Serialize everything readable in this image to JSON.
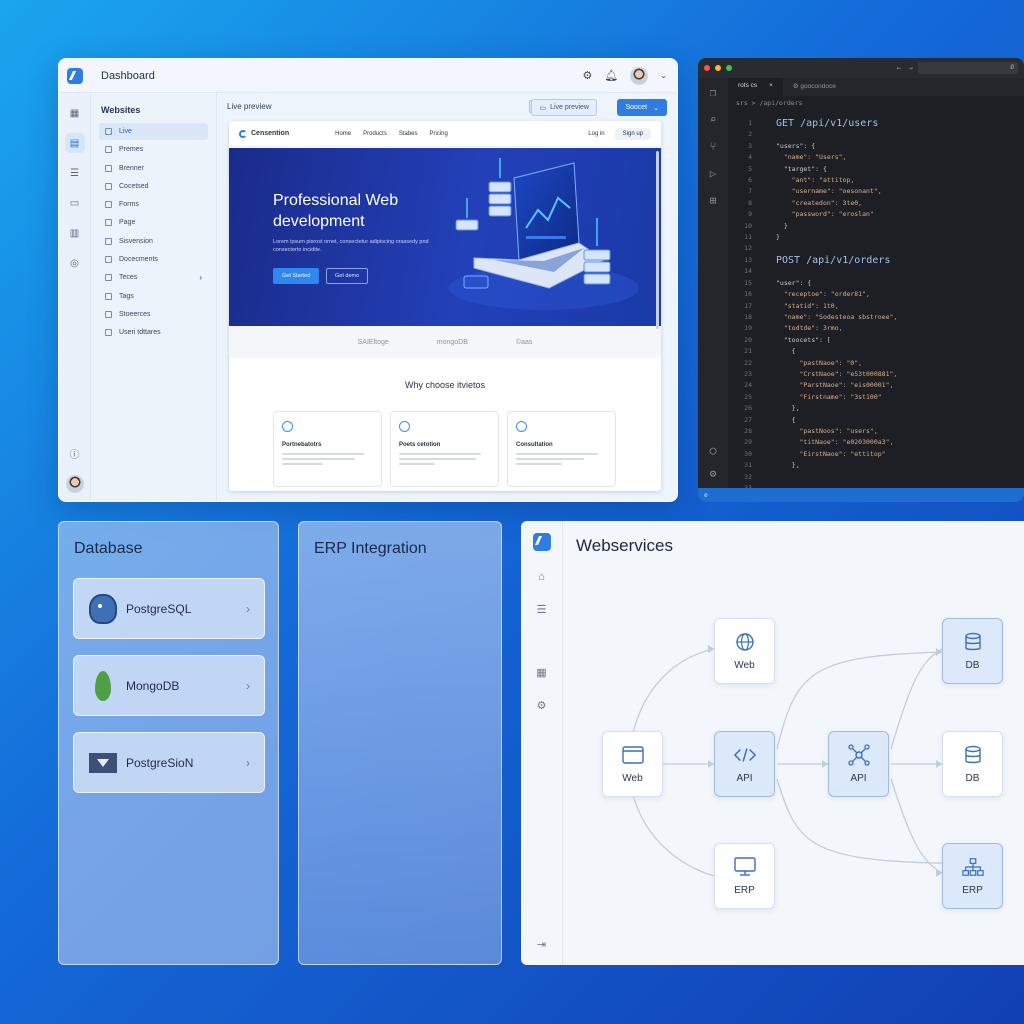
{
  "dashboard": {
    "title": "Dashboard",
    "sidebar_heading": "Websites",
    "sidebar_items": [
      "Live",
      "Premes",
      "Brenner",
      "Cocetsed",
      "Forms",
      "Page",
      "Sisvension",
      "Docecments",
      "Teces",
      "Tags",
      "Stoeerces",
      "Useri tdttares"
    ],
    "main_label": "Live preview",
    "btn_live_preview": "Live preview",
    "btn_secondary": "Soocet",
    "site": {
      "brand": "Censention",
      "nav": [
        "Home",
        "Products",
        "Stabes",
        "Pricing"
      ],
      "login": "Log in",
      "signup": "Sign up",
      "hero_title": "Professional Web development",
      "hero_text": "Lorem ipsum pisrost ornet, consectetur adipiscing orassedy pnd consecterto incidite.",
      "hero_btn_primary": "Get Started",
      "hero_btn_secondary": "Get demo",
      "logos": [
        "SAIEltoge",
        "mongoDB",
        "©aas"
      ],
      "why_title": "Why choose itvietos",
      "cards": [
        "Portnebatotrs",
        "Poets cetotion",
        "Consultation"
      ]
    }
  },
  "code_editor": {
    "tabs": [
      "rots cs",
      "goocondoce"
    ],
    "breadcrumb": "srs  >  /api/orders",
    "search": "Ø",
    "status": "⊘",
    "line_numbers": [
      "1",
      "2",
      "3",
      "4",
      "5",
      "6",
      "7",
      "8",
      "9",
      "10",
      "11",
      "12",
      "13",
      "14",
      "15",
      "16",
      "17",
      "18",
      "19",
      "20",
      "21",
      "22",
      "23",
      "24",
      "25",
      "26",
      "27",
      "28",
      "29",
      "30",
      "31",
      "32",
      "33"
    ],
    "code": [
      {
        "text": "GET /api/v1/users",
        "cls": "big kw"
      },
      {
        "text": "",
        "cls": ""
      },
      {
        "text": "\"users\": {",
        "cls": ""
      },
      {
        "text": "  \"name\": \"Users\",",
        "cls": "str"
      },
      {
        "text": "  \"target\": {",
        "cls": ""
      },
      {
        "text": "    \"ant\": \"attitop,",
        "cls": "str"
      },
      {
        "text": "    \"username\": \"oesonant\",",
        "cls": "str"
      },
      {
        "text": "    \"createdon\": 3te0,",
        "cls": "str"
      },
      {
        "text": "    \"password\": \"eroslan\"",
        "cls": "str"
      },
      {
        "text": "  }",
        "cls": ""
      },
      {
        "text": "}",
        "cls": ""
      },
      {
        "text": "",
        "cls": ""
      },
      {
        "text": "POST /api/v1/orders",
        "cls": "big kw"
      },
      {
        "text": "",
        "cls": ""
      },
      {
        "text": "\"user\": {",
        "cls": ""
      },
      {
        "text": "  \"receptoe\": \"order81\",",
        "cls": "str"
      },
      {
        "text": "  \"statid\": 1t0,",
        "cls": "str"
      },
      {
        "text": "  \"name\": \"Sodesteoa sbstroee\",",
        "cls": "str"
      },
      {
        "text": "  \"todtde\": 3rmo,",
        "cls": "str"
      },
      {
        "text": "  \"toocets\": [",
        "cls": ""
      },
      {
        "text": "    {",
        "cls": ""
      },
      {
        "text": "      \"pastNaoe\": \"0\",",
        "cls": "str"
      },
      {
        "text": "      \"CrstNaoe\": \"e53t000881\",",
        "cls": "str"
      },
      {
        "text": "      \"ParstNaoe\": \"eis00001\",",
        "cls": "str"
      },
      {
        "text": "      \"Firstname\": \"3st100\"",
        "cls": "str"
      },
      {
        "text": "    },",
        "cls": ""
      },
      {
        "text": "    {",
        "cls": ""
      },
      {
        "text": "      \"pastNoos\": \"users\",",
        "cls": "str"
      },
      {
        "text": "      \"titNaoe\": \"e0203000a3\",",
        "cls": "str"
      },
      {
        "text": "      \"EirstNaoe\": \"ettitop\"",
        "cls": "str"
      },
      {
        "text": "    },",
        "cls": ""
      }
    ]
  },
  "database": {
    "title": "Database",
    "items": [
      "PostgreSQL",
      "MongoDB",
      "PostgreSioN"
    ]
  },
  "erp": {
    "title": "ERP Integration"
  },
  "webservices": {
    "title": "Webservices",
    "nodes": {
      "web_top": "Web",
      "db_top": "DB",
      "web_left": "Web",
      "api_mid": "API",
      "api_right": "API",
      "db_mid": "DB",
      "erp_bottom": "ERP",
      "erp_right": "ERP"
    }
  },
  "colors": {
    "accent": "#2f7de1",
    "code_bg": "#1e1f24",
    "status_bar": "#1c6fd1"
  }
}
